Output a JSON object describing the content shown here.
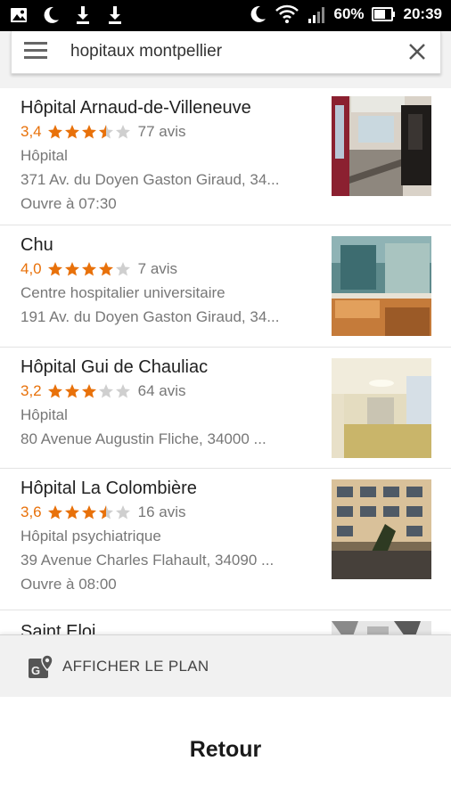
{
  "status_bar": {
    "battery": "60%",
    "time": "20:39",
    "left_icons": [
      "image-icon",
      "moon-icon",
      "download-icon",
      "download-icon"
    ],
    "right_icons": [
      "moon-icon",
      "wifi-icon",
      "signal-icon",
      "battery-icon"
    ]
  },
  "search": {
    "query": "hopitaux montpellier"
  },
  "results": [
    {
      "name": "Hôpital Arnaud-de-Villeneuve",
      "rating": "3,4",
      "stars": 3.4,
      "reviews": "77 avis",
      "category": "Hôpital",
      "address": "371 Av. du Doyen Gaston Giraud, 34...",
      "hours": "Ouvre à 07:30"
    },
    {
      "name": "Chu",
      "rating": "4,0",
      "stars": 4.0,
      "reviews": "7 avis",
      "category": "Centre hospitalier universitaire",
      "address": "191 Av. du Doyen Gaston Giraud, 34...",
      "hours": ""
    },
    {
      "name": "Hôpital Gui de Chauliac",
      "rating": "3,2",
      "stars": 3.2,
      "reviews": "64 avis",
      "category": "Hôpital",
      "address": "80 Avenue Augustin Fliche, 34000 ...",
      "hours": ""
    },
    {
      "name": "Hôpital La Colombière",
      "rating": "3,6",
      "stars": 3.6,
      "reviews": "16 avis",
      "category": "Hôpital psychiatrique",
      "address": "39 Avenue Charles Flahault, 34090 ...",
      "hours": "Ouvre à 08:00"
    },
    {
      "name": "Saint Eloi",
      "rating": "",
      "stars": 0,
      "reviews": "",
      "category": "",
      "address": "",
      "hours": ""
    }
  ],
  "map_button": {
    "label": "AFFICHER LE PLAN"
  },
  "back_button": {
    "label": "Retour"
  },
  "colors": {
    "star_filled": "#e8710a",
    "star_empty": "#cfcfcf",
    "rating_text": "#e8710a"
  }
}
